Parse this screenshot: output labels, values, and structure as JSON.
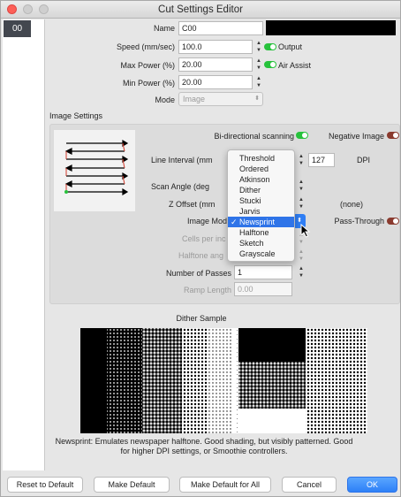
{
  "window": {
    "title": "Cut Settings Editor"
  },
  "sidebar": {
    "items": [
      {
        "label": "00"
      }
    ]
  },
  "fields": {
    "name": {
      "label": "Name",
      "value": "C00"
    },
    "speed": {
      "label": "Speed (mm/sec)",
      "value": "100.0"
    },
    "max_power": {
      "label": "Max Power (%)",
      "value": "20.00"
    },
    "min_power": {
      "label": "Min Power (%)",
      "value": "20.00"
    },
    "mode": {
      "label": "Mode",
      "value": "Image"
    }
  },
  "toggles": {
    "output": {
      "label": "Output",
      "on": true
    },
    "air_assist": {
      "label": "Air Assist",
      "on": true
    }
  },
  "image_settings": {
    "section_label": "Image Settings",
    "bidirectional": {
      "label": "Bi-directional scanning",
      "on": true
    },
    "negative_image": {
      "label": "Negative Image",
      "on": false
    },
    "line_interval": {
      "label": "Line Interval (mm",
      "dpi_value": "127",
      "dpi_label": "DPI"
    },
    "scan_angle": {
      "label": "Scan Angle (deg"
    },
    "z_offset": {
      "label": "Z Offset (mm",
      "value": "(none)"
    },
    "image_mode": {
      "label": "Image Mod"
    },
    "pass_through": {
      "label": "Pass-Through",
      "on": false
    },
    "cells_per_inch": {
      "label": "Cells per inc"
    },
    "halftone_angle": {
      "label": "Halftone ang"
    },
    "passes": {
      "label": "Number of Passes",
      "value": "1"
    },
    "ramp_length": {
      "label": "Ramp Length",
      "placeholder": "0.00"
    }
  },
  "image_mode_menu": {
    "selected": "Newsprint",
    "options": [
      "Threshold",
      "Ordered",
      "Atkinson",
      "Dither",
      "Stucki",
      "Jarvis",
      "Newsprint",
      "Halftone",
      "Sketch",
      "Grayscale"
    ]
  },
  "dither": {
    "title": "Dither Sample",
    "description": "Newsprint: Emulates newspaper halftone. Good shading, but visibly patterned. Good for higher DPI settings, or Smoothie controllers."
  },
  "buttons": {
    "reset": "Reset to Default",
    "make_default": "Make Default",
    "make_default_all": "Make Default for All",
    "cancel": "Cancel",
    "ok": "OK"
  },
  "colors": {
    "accent": "#2f74e8",
    "toggle_on": "#27c23c",
    "toggle_off": "#8a3a2e"
  }
}
